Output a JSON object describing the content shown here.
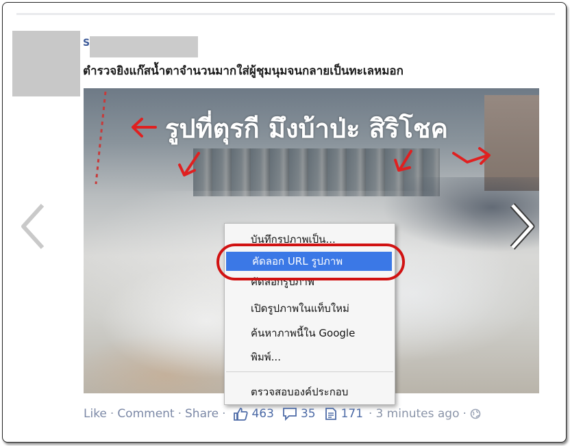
{
  "post": {
    "author_initial": "S",
    "text": "ตำรวจยิงแก๊สน้ำตาจำนวนมากใส่ผู้ชุมนุมจนกลายเป็นทะเลหมอก"
  },
  "photo": {
    "caption": "รูปที่ตุรกี มึงบ้าป่ะ สิริโชค",
    "nav_prev": "previous-photo",
    "nav_next": "next-photo"
  },
  "context_menu": {
    "items": [
      {
        "label": "บันทึกรูปภาพเป็น...",
        "selected": false
      },
      {
        "label": "คัดลอก URL รูปภาพ",
        "selected": true
      },
      {
        "label": "คัดลอกรูปภาพ",
        "selected": false
      },
      {
        "label": "เปิดรูปภาพในแท็บใหม่",
        "selected": false
      },
      {
        "label": "ค้นหาภาพนี้ใน Google",
        "selected": false
      },
      {
        "label": "พิมพ์...",
        "selected": false
      },
      {
        "label": "ตรวจสอบองค์ประกอบ",
        "selected": false
      }
    ],
    "highlight_color": "#d11212",
    "selection_color": "#3b78e6"
  },
  "footer": {
    "like": "Like",
    "comment": "Comment",
    "share": "Share",
    "likes_count": "463",
    "comments_count": "35",
    "shares_count": "171",
    "time": "3 minutes ago",
    "separator": "·"
  },
  "colors": {
    "link": "#7b88a6",
    "name_blue": "#3b5998",
    "annotation_red": "#e02020"
  }
}
